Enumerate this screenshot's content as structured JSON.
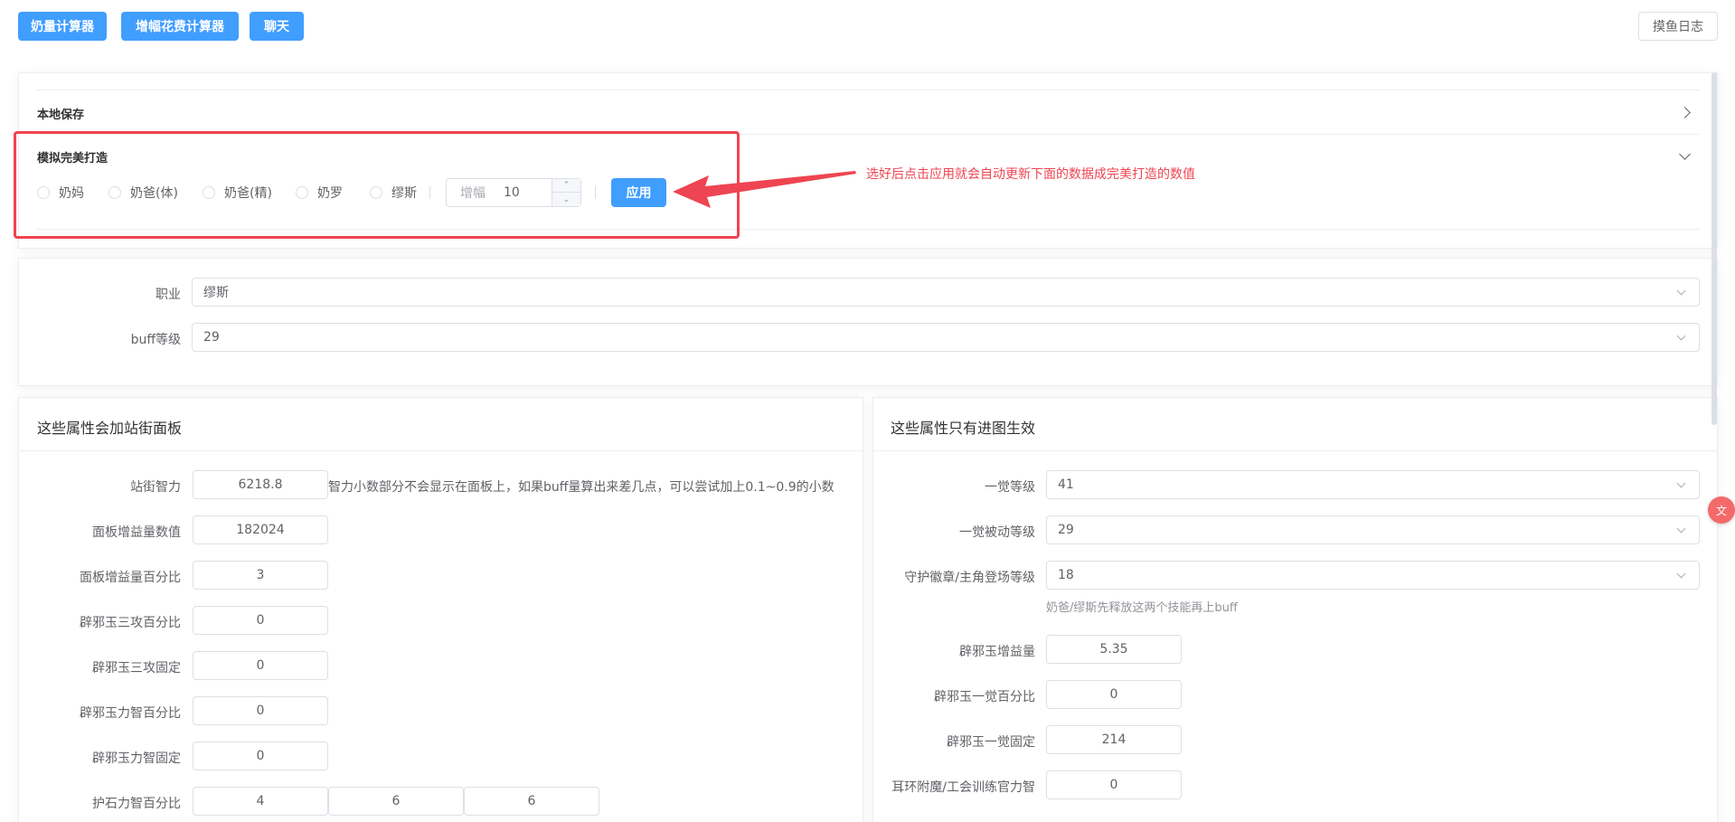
{
  "toolbar": {
    "milk_calc": "奶量计算器",
    "amp_calc": "增幅花费计算器",
    "chat": "聊天",
    "log": "摸鱼日志"
  },
  "collapse": {
    "local_save": "本地保存",
    "perfect_title": "模拟完美打造",
    "radios": [
      "奶妈",
      "奶爸(体)",
      "奶爸(精)",
      "奶罗",
      "缪斯"
    ],
    "amp_prefix": "增幅",
    "amp_value": "10",
    "apply": "应用",
    "annotation": "选好后点击应用就会自动更新下面的数据成完美打造的数值"
  },
  "base": {
    "job_label": "职业",
    "job_value": "缪斯",
    "buff_label": "buff等级",
    "buff_value": "29"
  },
  "left_panel": {
    "title": "这些属性会加站街面板",
    "rows": [
      {
        "label": "站街智力",
        "value": "6218.8"
      },
      {
        "label": "面板增益量数值",
        "value": "182024"
      },
      {
        "label": "面板增益量百分比",
        "value": "3"
      },
      {
        "label": "辟邪玉三攻百分比",
        "value": "0"
      },
      {
        "label": "辟邪玉三攻固定",
        "value": "0"
      },
      {
        "label": "辟邪玉力智百分比",
        "value": "0"
      },
      {
        "label": "辟邪玉力智固定",
        "value": "0"
      },
      {
        "label": "护石力智百分比",
        "values": [
          "4",
          "6",
          "6"
        ]
      }
    ],
    "int_hint": "智力小数部分不会显示在面板上，如果buff量算出来差几点，可以尝试加上0.1~0.9的小数"
  },
  "right_panel": {
    "title": "这些属性只有进图生效",
    "selects": [
      {
        "label": "一觉等级",
        "value": "41"
      },
      {
        "label": "一觉被动等级",
        "value": "29"
      },
      {
        "label": "守护徽章/主角登场等级",
        "value": "18"
      }
    ],
    "select_hint": "奶爸/缪斯先释放这两个技能再上buff",
    "rows": [
      {
        "label": "辟邪玉增益量",
        "value": "5.35"
      },
      {
        "label": "辟邪玉一觉百分比",
        "value": "0"
      },
      {
        "label": "辟邪玉一觉固定",
        "value": "214"
      },
      {
        "label": "耳环附魔/工会训练官力智",
        "value": "0"
      }
    ]
  },
  "colors": {
    "primary": "#409eff",
    "annotation": "#ef4451"
  },
  "side_float_icon": "translate-icon"
}
